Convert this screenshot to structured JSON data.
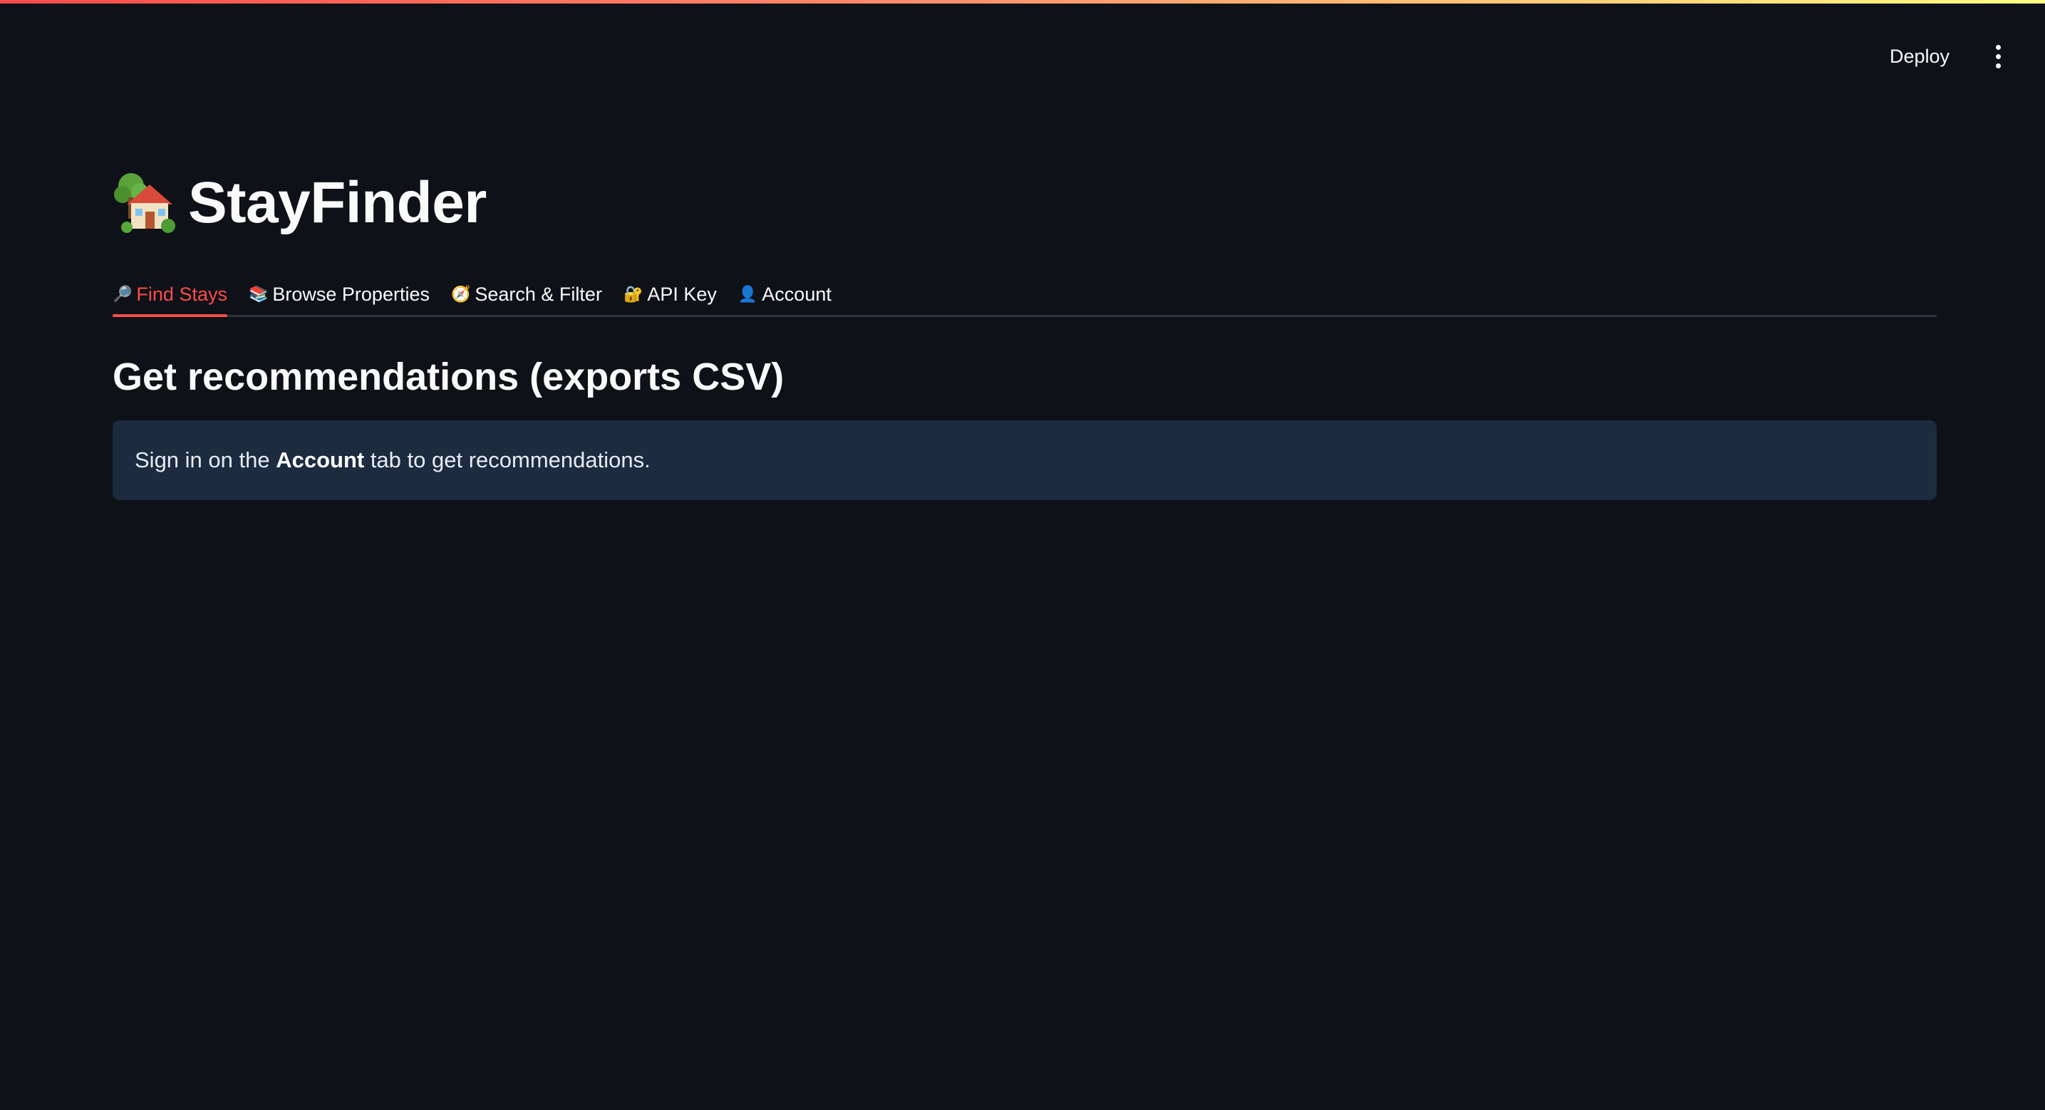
{
  "header": {
    "deploy_label": "Deploy",
    "menu_icon": "kebab-menu-icon"
  },
  "app": {
    "title": "StayFinder",
    "title_icon": "house-with-garden-icon"
  },
  "tabs": [
    {
      "label": "Find Stays",
      "icon": "magnifier-icon",
      "glyph": "🔎",
      "active": true
    },
    {
      "label": "Browse Properties",
      "icon": "books-icon",
      "glyph": "📚",
      "active": false
    },
    {
      "label": "Search & Filter",
      "icon": "compass-icon",
      "glyph": "🧭",
      "active": false
    },
    {
      "label": "API Key",
      "icon": "lock-key-icon",
      "glyph": "🔐",
      "active": false
    },
    {
      "label": "Account",
      "icon": "user-silhouette-icon",
      "glyph": "👤",
      "active": false
    }
  ],
  "main": {
    "heading": "Get recommendations (exports CSV)",
    "info": {
      "prefix": "Sign in on the ",
      "emphasis": "Account",
      "suffix": " tab to get recommendations."
    }
  },
  "colors": {
    "background": "#0e1117",
    "accent": "#ff4b4b",
    "info_bg": "#1c2b3f"
  }
}
